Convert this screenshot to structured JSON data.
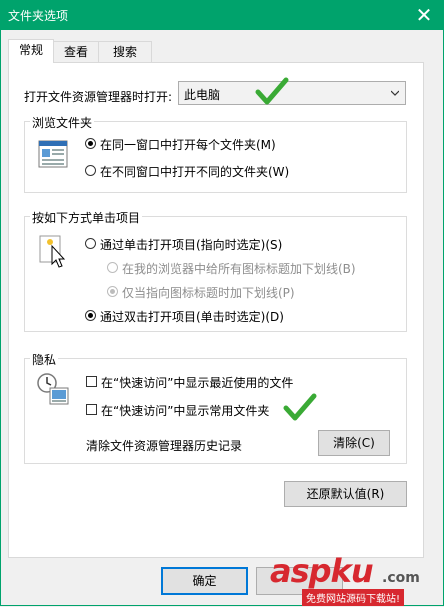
{
  "window": {
    "title": "文件夹选项",
    "close_glyph": "✕"
  },
  "tabs": [
    {
      "label": "常规"
    },
    {
      "label": "查看"
    },
    {
      "label": "搜索"
    }
  ],
  "general": {
    "open_explorer_label": "打开文件资源管理器时打开:",
    "open_explorer_value": "此电脑",
    "browse_group": {
      "title": "浏览文件夹",
      "options": [
        {
          "label": "在同一窗口中打开每个文件夹(M)",
          "selected": true
        },
        {
          "label": "在不同窗口中打开不同的文件夹(W)",
          "selected": false
        }
      ]
    },
    "click_group": {
      "title": "按如下方式单击项目",
      "options": [
        {
          "label": "通过单击打开项目(指向时选定)(S)",
          "selected": false
        },
        {
          "label": "在我的浏览器中给所有图标标题加下划线(B)",
          "selected": false,
          "disabled": true
        },
        {
          "label": "仅当指向图标标题时加下划线(P)",
          "selected": true,
          "disabled": true
        },
        {
          "label": "通过双击打开项目(单击时选定)(D)",
          "selected": true
        }
      ]
    },
    "privacy_group": {
      "title": "隐私",
      "checkboxes": [
        {
          "label": "在“快速访问”中显示最近使用的文件",
          "checked": false
        },
        {
          "label": "在“快速访问”中显示常用文件夹",
          "checked": false
        }
      ],
      "clear_history_label": "清除文件资源管理器历史记录",
      "clear_button": "清除(C)"
    },
    "restore_defaults_button": "还原默认值(R)"
  },
  "footer": {
    "ok_button": "确定",
    "watermark": {
      "text": "aspku",
      "suffix": ".com",
      "tagline": "免费网站源码下载站!"
    }
  },
  "colors": {
    "title_bar": "#00a36c",
    "check_mark": "#3aaa35",
    "watermark_red": "#d7282f"
  }
}
